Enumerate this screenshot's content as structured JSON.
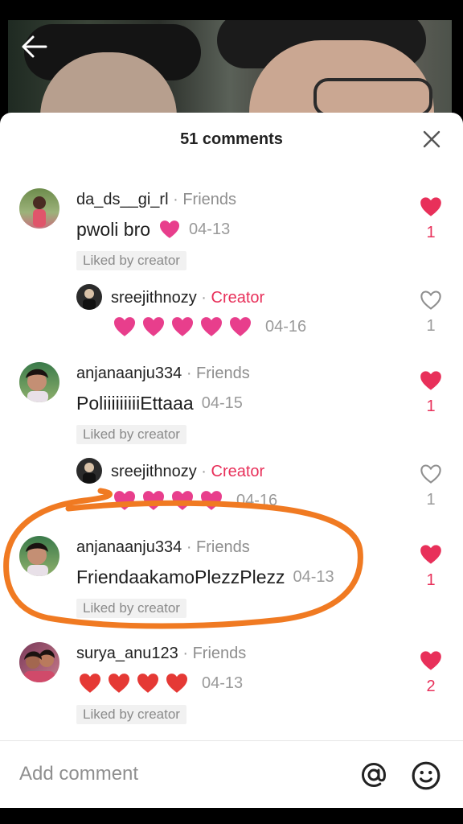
{
  "header": {
    "title": "51 comments"
  },
  "comments": [
    {
      "username": "da_ds__gi_rl",
      "tag": "Friends",
      "text": "pwoli bro",
      "date": "04-13",
      "liked_by_creator": "Liked by creator",
      "like_count": "1",
      "liked": true
    },
    {
      "username": "sreejithnozy",
      "tag": "Creator",
      "text": "",
      "date": "04-16",
      "like_count": "1",
      "liked": false,
      "reply": true
    },
    {
      "username": "anjanaanju334",
      "tag": "Friends",
      "text": "PoliiiiiiiiiEttaaa",
      "date": "04-15",
      "liked_by_creator": "Liked by creator",
      "like_count": "1",
      "liked": true
    },
    {
      "username": "sreejithnozy",
      "tag": "Creator",
      "text": "",
      "date": "04-16",
      "like_count": "1",
      "liked": false,
      "reply": true
    },
    {
      "username": "anjanaanju334",
      "tag": "Friends",
      "text": "FriendaakamoPlezzPlezz",
      "date": "04-13",
      "liked_by_creator": "Liked by creator",
      "like_count": "1",
      "liked": true,
      "highlighted": true
    },
    {
      "username": "surya_anu123",
      "tag": "Friends",
      "text": "",
      "date": "04-13",
      "liked_by_creator": "Liked by creator",
      "like_count": "2",
      "liked": true
    }
  ],
  "separator": "·",
  "input": {
    "placeholder": "Add comment"
  },
  "icons": {
    "back": "back-arrow-icon",
    "close": "close-icon",
    "heart": "heart-icon",
    "mention": "at-sign-icon",
    "emoji": "emoji-icon"
  },
  "colors": {
    "accent": "#e8305a",
    "annotation": "#f07a22"
  }
}
